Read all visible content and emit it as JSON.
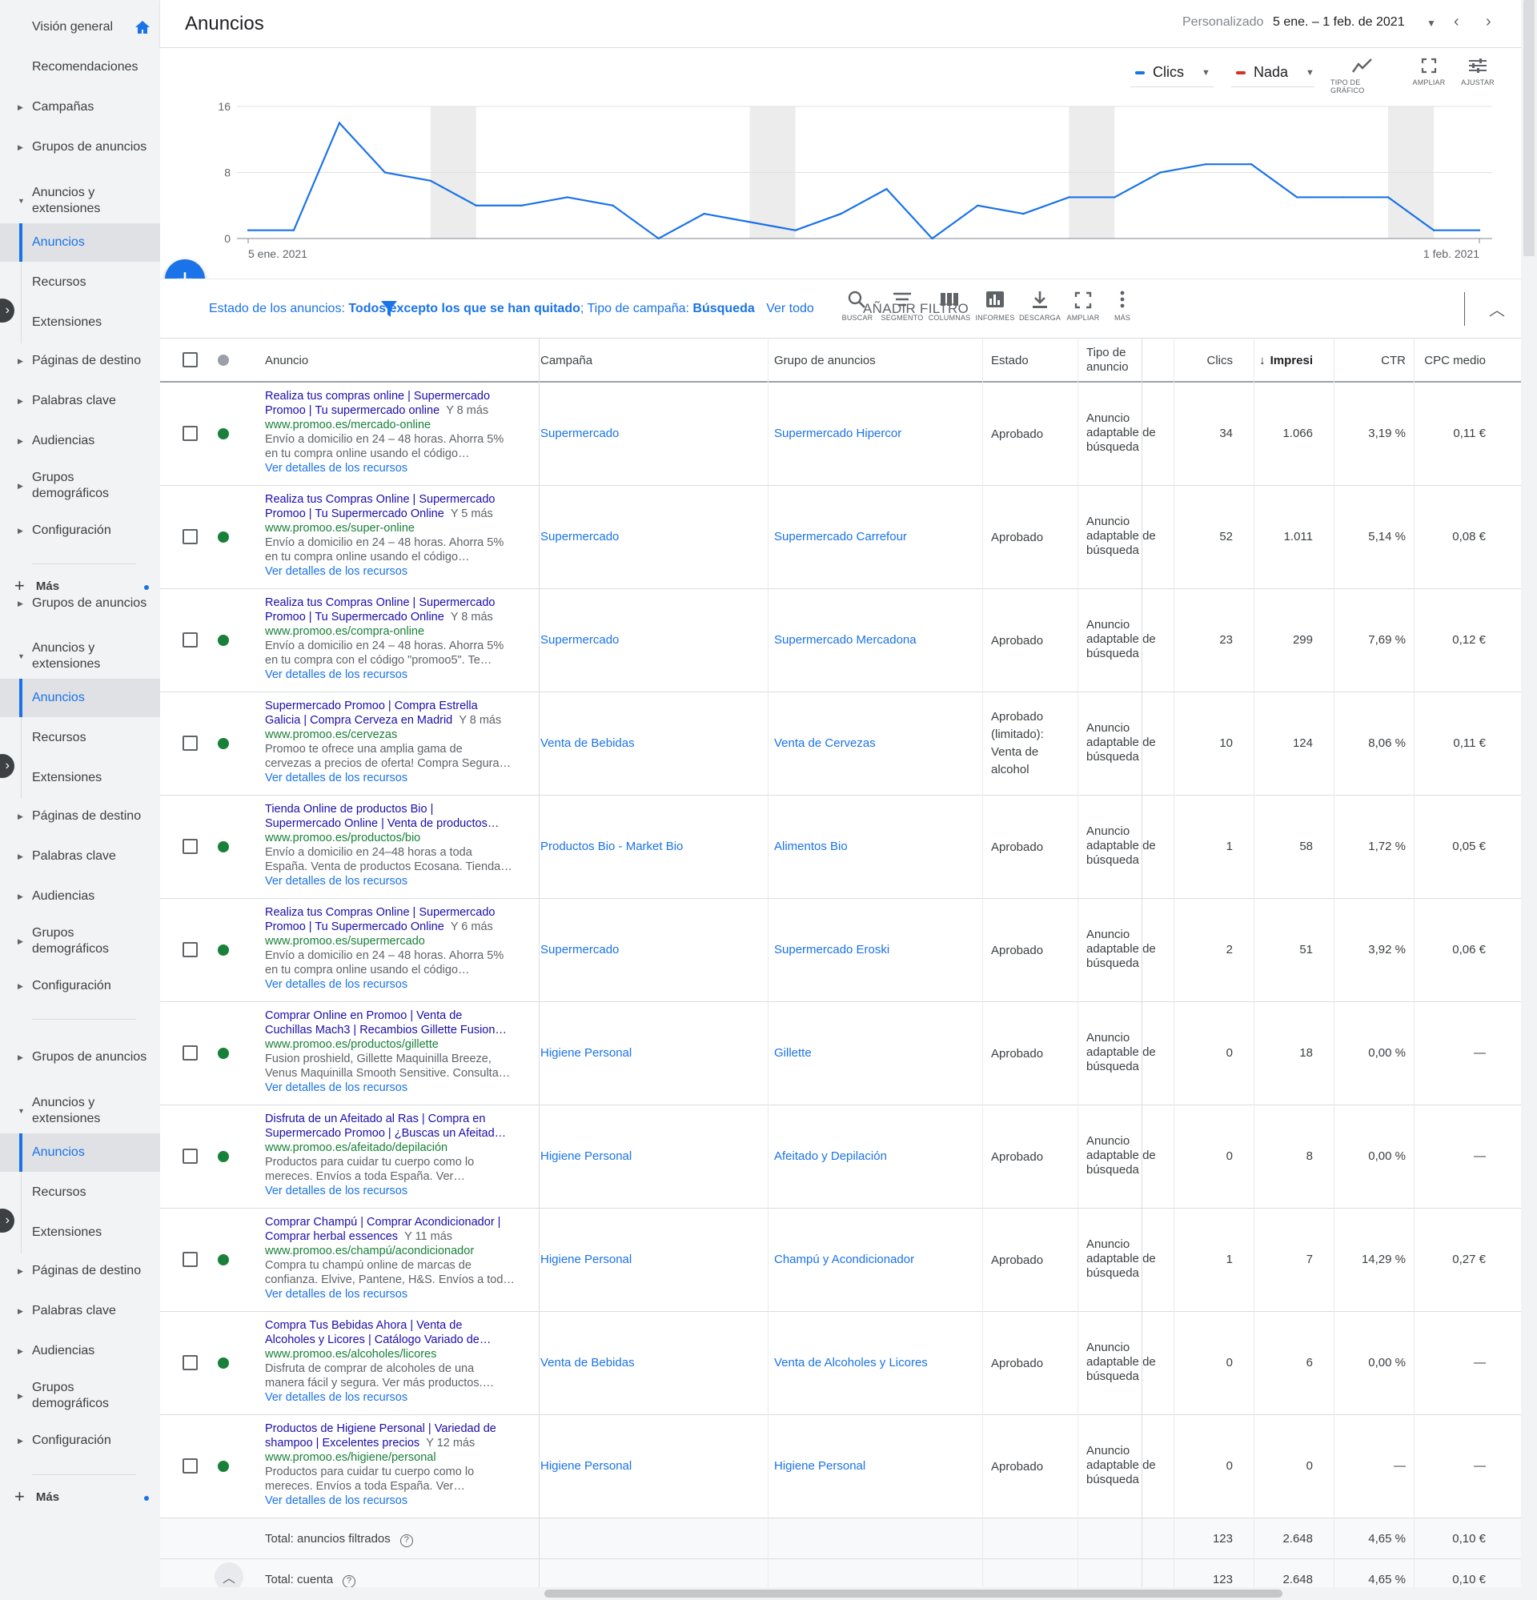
{
  "sidebar": {
    "overview": "Visión general",
    "recommendations": "Recomendaciones",
    "campaigns": "Campañas",
    "ad_groups": "Grupos de anuncios",
    "ads_ext": "Anuncios y extensiones",
    "ads": "Anuncios",
    "assets": "Recursos",
    "extensions": "Extensiones",
    "landing": "Páginas de destino",
    "keywords": "Palabras clave",
    "audiences": "Audiencias",
    "demographics": "Grupos demográficos",
    "settings": "Configuración",
    "more": "Más"
  },
  "header": {
    "title": "Anuncios",
    "date_custom": "Personalizado",
    "date_range": "5 ene. – 1 feb. de 2021"
  },
  "chart_controls": {
    "metric1": "Clics",
    "metric1_color": "#1a73e8",
    "metric2": "Nada",
    "metric2_color": "#d93025",
    "tool_chart_type": "TIPO DE GRÁFICO",
    "tool_expand": "AMPLIAR",
    "tool_adjust": "AJUSTAR"
  },
  "chart_data": {
    "type": "line",
    "x_start_label": "5 ene. 2021",
    "x_end_label": "1 feb. 2021",
    "y_ticks": [
      "16",
      "8",
      "0"
    ],
    "ylim": [
      0,
      16
    ],
    "series": [
      {
        "color": "#1a73e8",
        "values": [
          1,
          1,
          14,
          8,
          7,
          4,
          4,
          5,
          4,
          0,
          3,
          2,
          1,
          3,
          6,
          0,
          4,
          3,
          5,
          5,
          8,
          9,
          9,
          5,
          5,
          5,
          1,
          1
        ]
      }
    ],
    "weekend_bands": [
      [
        4,
        5
      ],
      [
        11,
        12
      ],
      [
        18,
        19
      ],
      [
        25,
        26
      ]
    ]
  },
  "filter": {
    "status_label": "Estado de los anuncios:",
    "status_value": "Todos excepto los que se han quitado",
    "type_label": "Tipo de campaña:",
    "type_value": "Búsqueda",
    "see_all": "Ver todo",
    "add_filter": "AÑADIR FILTRO",
    "tools": {
      "search": "BUSCAR",
      "segment": "SEGMENTO",
      "columns": "COLUMNAS",
      "reports": "INFORMES",
      "download": "DESCARGA",
      "expand": "AMPLIAR",
      "more": "MÁS"
    }
  },
  "table": {
    "headers": {
      "ad": "Anuncio",
      "campaign": "Campaña",
      "ad_group": "Grupo de anuncios",
      "status": "Estado",
      "type": "Tipo de anuncio",
      "clicks": "Clics",
      "impr": "Impresi",
      "ctr": "CTR",
      "cpc": "CPC medio"
    },
    "view_details": "Ver detalles de los recursos",
    "rows": [
      {
        "title1": "Realiza tus compras online | Supermercado",
        "title2": "Promoo | Tu supermercado online",
        "more": "Y 8 más",
        "url": "www.promoo.es/mercado-online",
        "desc1": "Envío a domicilio en 24 – 48 horas. Ahorra 5%",
        "desc2": "en tu compra online usando el código…",
        "campaign": "Supermercado",
        "ad_group": "Supermercado Hipercor",
        "status": "Aprobado",
        "type": "Anuncio adaptable de búsqueda",
        "clicks": "34",
        "impr": "1.066",
        "ctr": "3,19 %",
        "cpc": "0,11 €"
      },
      {
        "title1": "Realiza tus Compras Online | Supermercado",
        "title2": "Promoo | Tu Supermercado Online",
        "more": "Y 5 más",
        "url": "www.promoo.es/super-online",
        "desc1": "Envío a domicilio en 24 – 48 horas. Ahorra 5%",
        "desc2": "en tu compra online usando el código…",
        "campaign": "Supermercado",
        "ad_group": "Supermercado Carrefour",
        "status": "Aprobado",
        "type": "Anuncio adaptable de búsqueda",
        "clicks": "52",
        "impr": "1.011",
        "ctr": "5,14 %",
        "cpc": "0,08 €"
      },
      {
        "title1": "Realiza tus Compras Online | Supermercado",
        "title2": "Promoo | Tu Supermercado Online",
        "more": "Y 8 más",
        "url": "www.promoo.es/compra-online",
        "desc1": "Envío a domicilio en 24 – 48 horas. Ahorra 5%",
        "desc2": "en tu compra con el código \"promoo5\". Te…",
        "campaign": "Supermercado",
        "ad_group": "Supermercado Mercadona",
        "status": "Aprobado",
        "type": "Anuncio adaptable de búsqueda",
        "clicks": "23",
        "impr": "299",
        "ctr": "7,69 %",
        "cpc": "0,12 €"
      },
      {
        "title1": "Supermercado Promoo | Compra Estrella",
        "title2": "Galicia | Compra Cerveza en Madrid",
        "more": "Y 8 más",
        "url": "www.promoo.es/cervezas",
        "desc1": "Promoo te ofrece una amplia gama de",
        "desc2": "cervezas a precios de oferta! Compra Segura…",
        "campaign": "Venta de Bebidas",
        "ad_group": "Venta de Cervezas",
        "status": "Aprobado (limitado): Venta de alcohol",
        "type": "Anuncio adaptable de búsqueda",
        "clicks": "10",
        "impr": "124",
        "ctr": "8,06 %",
        "cpc": "0,11 €"
      },
      {
        "title1": "Tienda Online de productos Bio |",
        "title2": "Supermercado Online | Venta de productos…",
        "more": "",
        "url": "www.promoo.es/productos/bio",
        "desc1": "Envío a domicilio en 24–48 horas a toda",
        "desc2": "España. Venta de productos Ecosana. Tienda…",
        "campaign": "Productos Bio - Market Bio",
        "ad_group": "Alimentos Bio",
        "status": "Aprobado",
        "type": "Anuncio adaptable de búsqueda",
        "clicks": "1",
        "impr": "58",
        "ctr": "1,72 %",
        "cpc": "0,05 €"
      },
      {
        "title1": "Realiza tus Compras Online | Supermercado",
        "title2": "Promoo | Tu Supermercado Online",
        "more": "Y 6 más",
        "url": "www.promoo.es/supermercado",
        "desc1": "Envío a domicilio en 24 – 48 horas. Ahorra 5%",
        "desc2": "en tu compra online usando el código…",
        "campaign": "Supermercado",
        "ad_group": "Supermercado Eroski",
        "status": "Aprobado",
        "type": "Anuncio adaptable de búsqueda",
        "clicks": "2",
        "impr": "51",
        "ctr": "3,92 %",
        "cpc": "0,06 €"
      },
      {
        "title1": "Comprar Online en Promoo | Venta de",
        "title2": "Cuchillas Mach3 | Recambios Gillette Fusion…",
        "more": "",
        "url": "www.promoo.es/productos/gillette",
        "desc1": "Fusion proshield, Gillette Maquinilla Breeze,",
        "desc2": "Venus Maquinilla Smooth Sensitive. Consulta…",
        "campaign": "Higiene Personal",
        "ad_group": "Gillette",
        "status": "Aprobado",
        "type": "Anuncio adaptable de búsqueda",
        "clicks": "0",
        "impr": "18",
        "ctr": "0,00 %",
        "cpc": "—"
      },
      {
        "title1": "Disfruta de un Afeitado al Ras | Compra en",
        "title2": "Supermercado Promoo | ¿Buscas un Afeitad…",
        "more": "",
        "url": "www.promoo.es/afeitado/depilación",
        "desc1": "Productos para cuidar tu cuerpo como lo",
        "desc2": "mereces. Envíos a toda España. Ver…",
        "campaign": "Higiene Personal",
        "ad_group": "Afeitado y Depilación",
        "status": "Aprobado",
        "type": "Anuncio adaptable de búsqueda",
        "clicks": "0",
        "impr": "8",
        "ctr": "0,00 %",
        "cpc": "—"
      },
      {
        "title1": "Comprar Champú | Comprar Acondicionador |",
        "title2": "Comprar herbal essences",
        "more": "Y 11 más",
        "url": "www.promoo.es/champú/acondicionador",
        "desc1": "Compra tu champú online de marcas de",
        "desc2": "confianza. Elvive, Pantene, H&S. Envíos a tod…",
        "campaign": "Higiene Personal",
        "ad_group": "Champú y Acondicionador",
        "status": "Aprobado",
        "type": "Anuncio adaptable de búsqueda",
        "clicks": "1",
        "impr": "7",
        "ctr": "14,29 %",
        "cpc": "0,27 €"
      },
      {
        "title1": "Compra Tus Bebidas Ahora | Venta de",
        "title2": "Alcoholes y Licores | Catálogo Variado de…",
        "more": "",
        "url": "www.promoo.es/alcoholes/licores",
        "desc1": "Disfruta de comprar de alcoholes de una",
        "desc2": "manera fácil y segura. Ver más productos.…",
        "campaign": "Venta de Bebidas",
        "ad_group": "Venta de Alcoholes y Licores",
        "status": "Aprobado",
        "type": "Anuncio adaptable de búsqueda",
        "clicks": "0",
        "impr": "6",
        "ctr": "0,00 %",
        "cpc": "—"
      },
      {
        "title1": "Productos de Higiene Personal | Variedad de",
        "title2": "shampoo | Excelentes precios",
        "more": "Y 12 más",
        "url": "www.promoo.es/higiene/personal",
        "desc1": "Productos para cuidar tu cuerpo como lo",
        "desc2": "mereces. Envíos a toda España. Ver…",
        "campaign": "Higiene Personal",
        "ad_group": "Higiene Personal",
        "status": "Aprobado",
        "type": "Anuncio adaptable de búsqueda",
        "clicks": "0",
        "impr": "0",
        "ctr": "—",
        "cpc": "—"
      }
    ],
    "totals": [
      {
        "label": "Total: anuncios filtrados",
        "clicks": "123",
        "impr": "2.648",
        "ctr": "4,65 %",
        "cpc": "0,10 €"
      },
      {
        "label": "Total: cuenta",
        "clicks": "123",
        "impr": "2.648",
        "ctr": "4,65 %",
        "cpc": "0,10 €"
      }
    ]
  }
}
